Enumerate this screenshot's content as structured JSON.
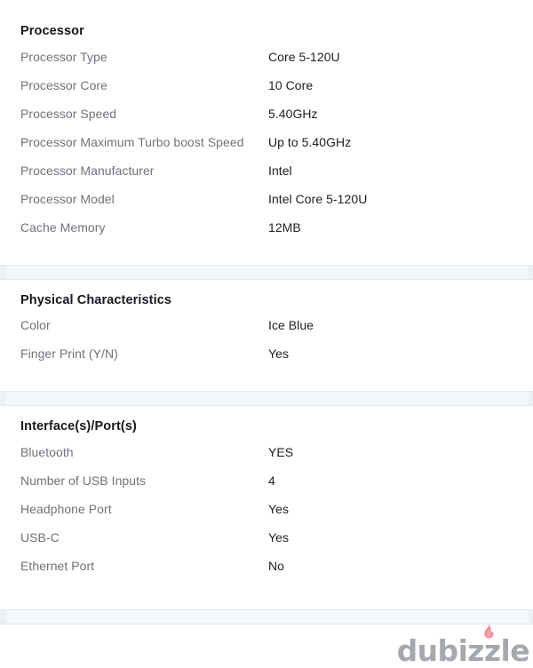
{
  "sections": [
    {
      "title": "Processor",
      "rows": [
        {
          "label": "Processor Type",
          "value": "Core 5-120U"
        },
        {
          "label": "Processor Core",
          "value": "10 Core"
        },
        {
          "label": "Processor Speed",
          "value": "5.40GHz"
        },
        {
          "label": "Processor Maximum Turbo boost Speed",
          "value": "Up to 5.40GHz"
        },
        {
          "label": "Processor Manufacturer",
          "value": "Intel"
        },
        {
          "label": "Processor Model",
          "value": "Intel Core 5-120U"
        },
        {
          "label": "Cache Memory",
          "value": "12MB"
        }
      ]
    },
    {
      "title": "Physical Characteristics",
      "rows": [
        {
          "label": "Color",
          "value": "Ice Blue"
        },
        {
          "label": "Finger Print (Y/N)",
          "value": "Yes"
        }
      ]
    },
    {
      "title": "Interface(s)/Port(s)",
      "rows": [
        {
          "label": "Bluetooth",
          "value": "YES"
        },
        {
          "label": "Number of USB Inputs",
          "value": "4"
        },
        {
          "label": "Headphone Port",
          "value": "Yes"
        },
        {
          "label": "USB-C",
          "value": "Yes"
        },
        {
          "label": "Ethernet Port",
          "value": "No"
        }
      ]
    }
  ],
  "watermark": {
    "text": "dubizzle",
    "icon": "flame-icon",
    "text_color": "#8d9197",
    "flame_color": "#e8747c"
  },
  "theme": {
    "background": "#ffffff",
    "label_color": "#6f7279",
    "value_color": "#1d1f23",
    "title_color": "#16181d",
    "divider_fill": "#f4f8fb",
    "divider_edge": "#e6eaf0"
  }
}
